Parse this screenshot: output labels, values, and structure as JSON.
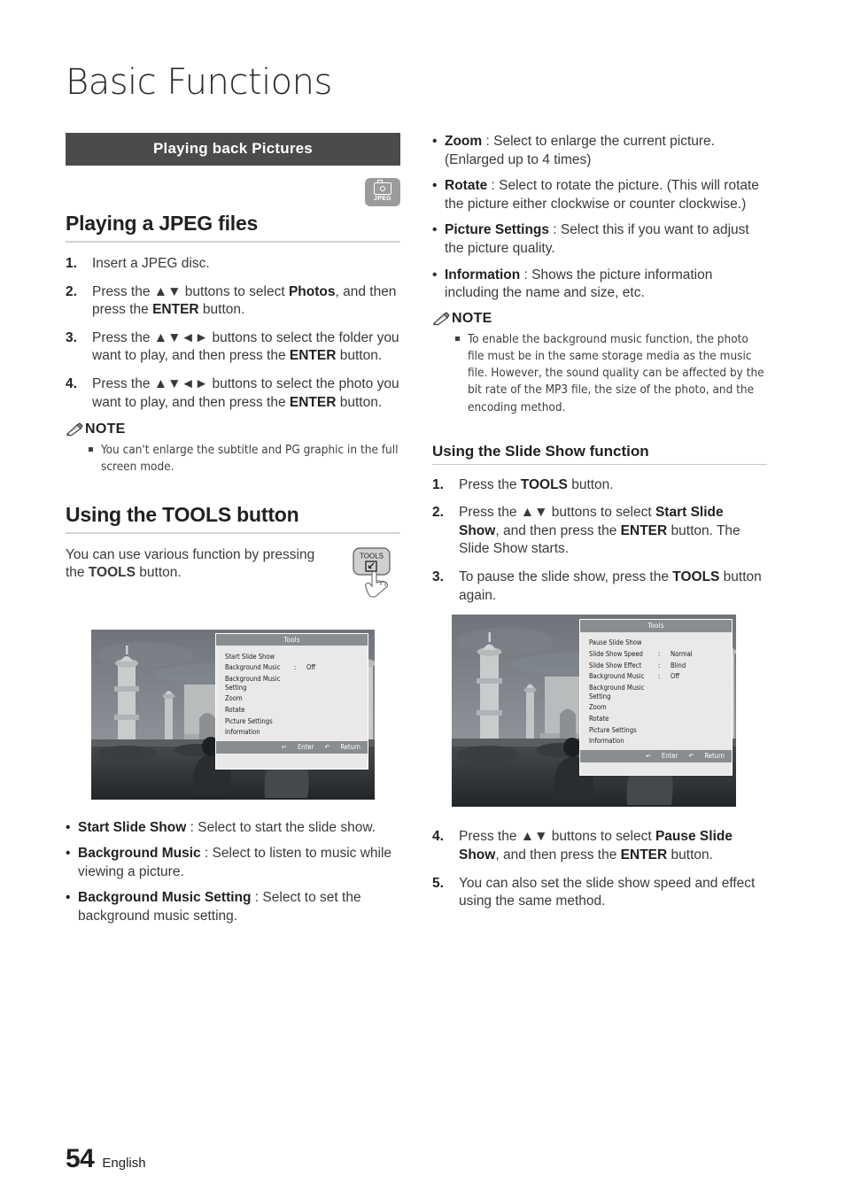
{
  "document": {
    "chapter_title": "Basic Functions",
    "section_bar": "Playing back Pictures",
    "media_badge": {
      "label": "JPEG",
      "icon": "camera-icon"
    },
    "page_number": "54",
    "language": "English"
  },
  "left_column": {
    "heading_jpeg": "Playing a JPEG files",
    "steps_jpeg": [
      {
        "num": "1.",
        "html": "Insert a JPEG disc."
      },
      {
        "num": "2.",
        "html": "Press the ▲▼ buttons to select <b>Photos</b>, and then press the <b>ENTER</b> button."
      },
      {
        "num": "3.",
        "html": "Press the ▲▼◄► buttons to select the folder you want to play, and then press the <b>ENTER</b> button."
      },
      {
        "num": "4.",
        "html": "Press the ▲▼◄► buttons to select the photo you want to play, and then press the <b>ENTER</b> button."
      }
    ],
    "note_label": "NOTE",
    "note_items": [
      "You can't enlarge the subtitle and PG graphic in the full screen mode."
    ],
    "heading_tools": "Using the TOOLS button",
    "tools_intro_html": "You can use various function by pressing the <b>TOOLS</b> button.",
    "tools_button_art": {
      "label": "TOOLS",
      "icon": "tools-remote-key-icon",
      "hand": "pressing-hand-icon"
    },
    "figure_tools": {
      "osd_title": "Tools",
      "rows": [
        {
          "label": "Start Slide Show",
          "sep": "",
          "value": ""
        },
        {
          "label": "Background Music",
          "sep": ":",
          "value": "Off"
        },
        {
          "label": "Background Music Setting",
          "sep": "",
          "value": ""
        },
        {
          "label": "Zoom",
          "sep": "",
          "value": ""
        },
        {
          "label": "Rotate",
          "sep": "",
          "value": ""
        },
        {
          "label": "Picture Settings",
          "sep": "",
          "value": ""
        },
        {
          "label": "Information",
          "sep": "",
          "value": ""
        }
      ],
      "footer_enter": "Enter",
      "footer_return": "Return"
    },
    "bullets_tools": [
      {
        "html": "<b>Start Slide Show</b> : Select to start the slide show."
      },
      {
        "html": "<b>Background Music</b> : Select to listen to music while viewing a picture."
      },
      {
        "html": "<b>Background Music Setting</b> : Select to set the background music setting."
      }
    ]
  },
  "right_column": {
    "bullets_tools_cont": [
      {
        "html": "<b>Zoom</b> : Select to enlarge the current picture. (Enlarged up to 4 times)"
      },
      {
        "html": "<b>Rotate</b> : Select to rotate the picture. (This will rotate the picture either clockwise or counter clockwise.)"
      },
      {
        "html": "<b>Picture Settings</b> : Select this if you want to adjust the picture quality."
      },
      {
        "html": "<b>Information</b> : Shows the picture information including the name and size, etc."
      }
    ],
    "note_label": "NOTE",
    "note_items": [
      "To enable the background music function, the photo file must be in the same storage media as the music file. However, the sound quality can be affected by the bit rate of the MP3 file, the size of the photo, and the encoding method."
    ],
    "heading_slideshow": "Using the Slide Show function",
    "steps_slideshow_a": [
      {
        "num": "1.",
        "html": "Press the <b>TOOLS</b> button."
      },
      {
        "num": "2.",
        "html": "Press the ▲▼ buttons to select <b>Start Slide Show</b>, and then press the <b>ENTER</b> button. The Slide Show starts."
      },
      {
        "num": "3.",
        "html": "To pause the slide show, press the <b>TOOLS</b> button again."
      }
    ],
    "figure_slideshow": {
      "osd_title": "Tools",
      "rows": [
        {
          "label": "Pause Slide Show",
          "sep": "",
          "value": ""
        },
        {
          "label": "Slide Show Speed",
          "sep": ":",
          "value": "Normal"
        },
        {
          "label": "Slide Show Effect",
          "sep": ":",
          "value": "Blind"
        },
        {
          "label": "Background Music",
          "sep": ":",
          "value": "Off"
        },
        {
          "label": "Background Music Setting",
          "sep": "",
          "value": ""
        },
        {
          "label": "Zoom",
          "sep": "",
          "value": ""
        },
        {
          "label": "Rotate",
          "sep": "",
          "value": ""
        },
        {
          "label": "Picture Settings",
          "sep": "",
          "value": ""
        },
        {
          "label": "Information",
          "sep": "",
          "value": ""
        }
      ],
      "footer_enter": "Enter",
      "footer_return": "Return"
    },
    "steps_slideshow_b": [
      {
        "num": "4.",
        "html": "Press the ▲▼ buttons to select <b>Pause Slide Show</b>, and then press the <b>ENTER</b> button."
      },
      {
        "num": "5.",
        "html": "You can also set the slide show speed and effect using the same method."
      }
    ]
  },
  "colors": {
    "section_bar_bg": "#4b4b4b",
    "text": "#231f20",
    "body_text": "#3a3a3a",
    "rule": "#d3d3d3",
    "osd_bg": "#e9e9e9",
    "osd_header": "#888d90"
  }
}
